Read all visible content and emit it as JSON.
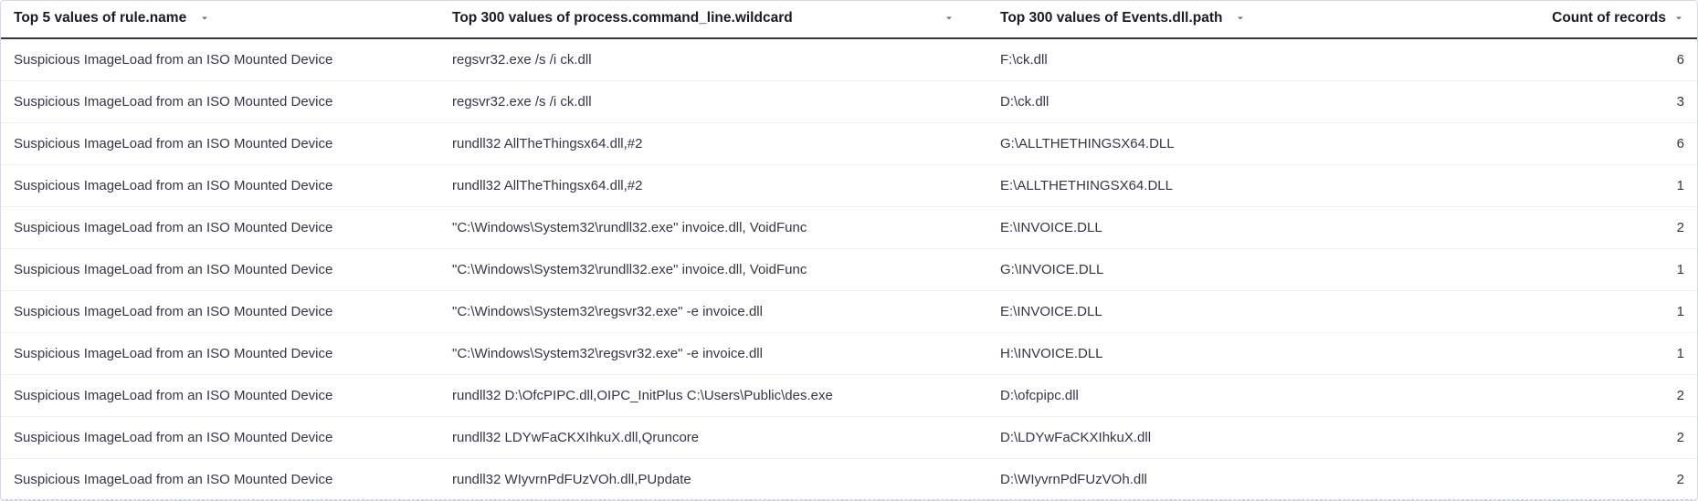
{
  "headers": {
    "rule_name": "Top 5 values of rule.name",
    "command_line": "Top 300 values of process.command_line.wildcard",
    "dll_path": "Top 300 values of Events.dll.path",
    "count": "Count of records"
  },
  "rows": [
    {
      "rule_name": "Suspicious ImageLoad from an ISO Mounted Device",
      "command_line": "regsvr32.exe /s /i ck.dll",
      "dll_path": "F:\\ck.dll",
      "count": "6"
    },
    {
      "rule_name": "Suspicious ImageLoad from an ISO Mounted Device",
      "command_line": "regsvr32.exe /s /i ck.dll",
      "dll_path": "D:\\ck.dll",
      "count": "3"
    },
    {
      "rule_name": "Suspicious ImageLoad from an ISO Mounted Device",
      "command_line": "rundll32 AllTheThingsx64.dll,#2",
      "dll_path": "G:\\ALLTHETHINGSX64.DLL",
      "count": "6"
    },
    {
      "rule_name": "Suspicious ImageLoad from an ISO Mounted Device",
      "command_line": "rundll32 AllTheThingsx64.dll,#2",
      "dll_path": "E:\\ALLTHETHINGSX64.DLL",
      "count": "1"
    },
    {
      "rule_name": "Suspicious ImageLoad from an ISO Mounted Device",
      "command_line": "\"C:\\Windows\\System32\\rundll32.exe\" invoice.dll, VoidFunc",
      "dll_path": "E:\\INVOICE.DLL",
      "count": "2"
    },
    {
      "rule_name": "Suspicious ImageLoad from an ISO Mounted Device",
      "command_line": "\"C:\\Windows\\System32\\rundll32.exe\" invoice.dll, VoidFunc",
      "dll_path": "G:\\INVOICE.DLL",
      "count": "1"
    },
    {
      "rule_name": "Suspicious ImageLoad from an ISO Mounted Device",
      "command_line": "\"C:\\Windows\\System32\\regsvr32.exe\" -e invoice.dll",
      "dll_path": "E:\\INVOICE.DLL",
      "count": "1"
    },
    {
      "rule_name": "Suspicious ImageLoad from an ISO Mounted Device",
      "command_line": "\"C:\\Windows\\System32\\regsvr32.exe\" -e invoice.dll",
      "dll_path": "H:\\INVOICE.DLL",
      "count": "1"
    },
    {
      "rule_name": "Suspicious ImageLoad from an ISO Mounted Device",
      "command_line": "rundll32 D:\\OfcPIPC.dll,OIPC_InitPlus C:\\Users\\Public\\des.exe",
      "dll_path": "D:\\ofcpipc.dll",
      "count": "2"
    },
    {
      "rule_name": "Suspicious ImageLoad from an ISO Mounted Device",
      "command_line": "rundll32 LDYwFaCKXIhkuX.dll,Qruncore",
      "dll_path": "D:\\LDYwFaCKXIhkuX.dll",
      "count": "2"
    },
    {
      "rule_name": "Suspicious ImageLoad from an ISO Mounted Device",
      "command_line": "rundll32 WIyvrnPdFUzVOh.dll,PUpdate",
      "dll_path": "D:\\WIyvrnPdFUzVOh.dll",
      "count": "2"
    }
  ]
}
